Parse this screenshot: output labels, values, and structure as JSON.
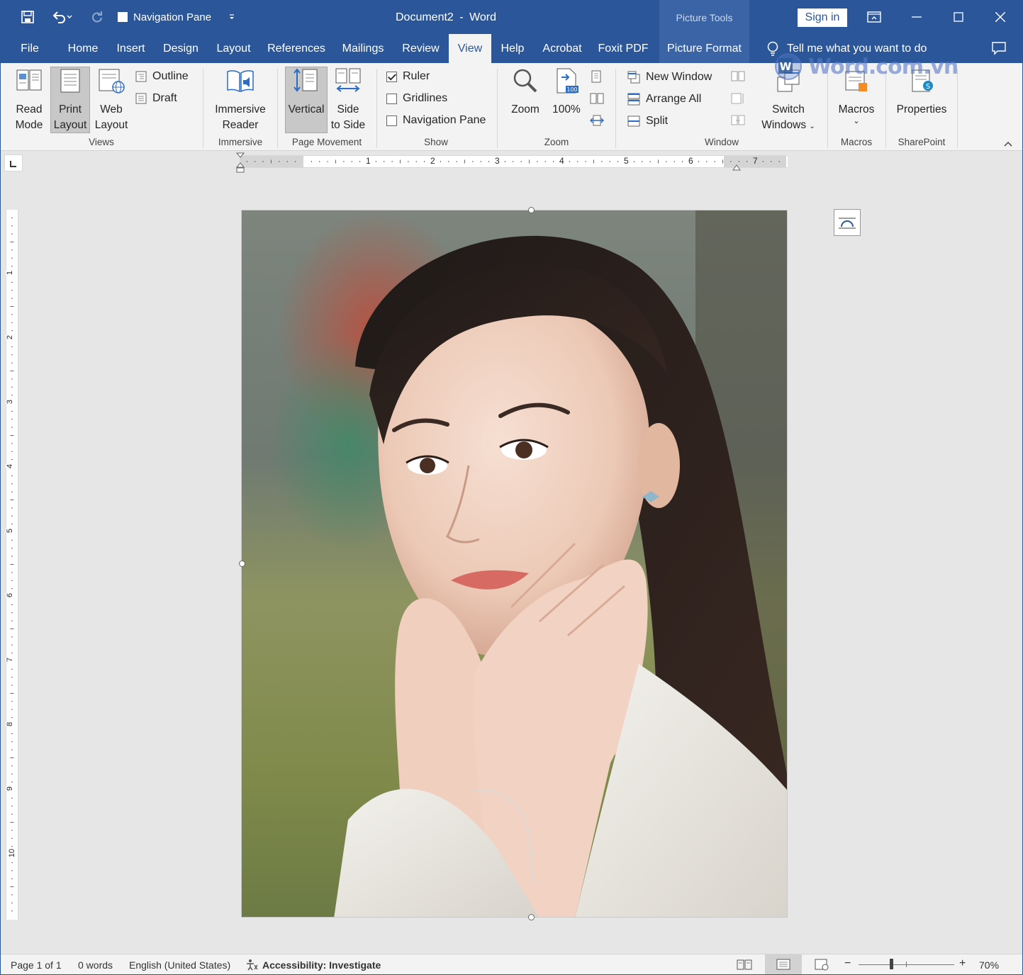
{
  "titlebar": {
    "qat_checkbox_label": "Navigation Pane",
    "document": "Document2",
    "separator": "-",
    "app": "Word",
    "picture_tools": "Picture Tools",
    "sign_in": "Sign in"
  },
  "tabs": {
    "file": "File",
    "home": "Home",
    "insert": "Insert",
    "design": "Design",
    "layout": "Layout",
    "references": "References",
    "mailings": "Mailings",
    "review": "Review",
    "view": "View",
    "help": "Help",
    "acrobat": "Acrobat",
    "foxit": "Foxit PDF",
    "picture_format": "Picture Format",
    "tell_me": "Tell me what you want to do",
    "active": "View"
  },
  "ribbon": {
    "read_mode": [
      "Read",
      "Mode"
    ],
    "print_layout": [
      "Print",
      "Layout"
    ],
    "web_layout": [
      "Web",
      "Layout"
    ],
    "outline": "Outline",
    "draft": "Draft",
    "group_views": "Views",
    "immersive_reader": [
      "Immersive",
      "Reader"
    ],
    "group_immersive": "Immersive",
    "vertical": "Vertical",
    "side_to_side": [
      "Side",
      "to Side"
    ],
    "group_page_movement": "Page Movement",
    "ruler": "Ruler",
    "ruler_checked": true,
    "gridlines": "Gridlines",
    "gridlines_checked": false,
    "navigation_pane": "Navigation Pane",
    "navigation_pane_checked": false,
    "group_show": "Show",
    "zoom": "Zoom",
    "zoom_100": "100%",
    "zoom_100_badge": "100",
    "group_zoom": "Zoom",
    "new_window": "New Window",
    "arrange_all": "Arrange All",
    "split": "Split",
    "switch_windows": [
      "Switch",
      "Windows"
    ],
    "group_window": "Window",
    "macros": "Macros",
    "group_macros": "Macros",
    "properties": "Properties",
    "group_sharepoint": "SharePoint"
  },
  "ruler": {
    "h_numbers": [
      "1",
      "2",
      "3",
      "4",
      "5",
      "6",
      "7"
    ],
    "v_numbers": [
      "1",
      "2",
      "3",
      "4",
      "5",
      "6",
      "7",
      "8",
      "9",
      "10"
    ]
  },
  "watermark": {
    "text": "Word.com.vn",
    "badge": "W"
  },
  "document": {
    "image": "portrait-photo-woman"
  },
  "status": {
    "page": "Page 1 of 1",
    "words": "0 words",
    "language": "English (United States)",
    "accessibility": "Accessibility: Investigate",
    "zoom_minus": "−",
    "zoom_plus": "+",
    "zoom": "70%"
  },
  "colors": {
    "word_blue": "#2b579a",
    "picture_tools_bg": "#3a64a6",
    "ribbon_bg": "#f3f3f3",
    "canvas_bg": "#e6e6e6"
  }
}
